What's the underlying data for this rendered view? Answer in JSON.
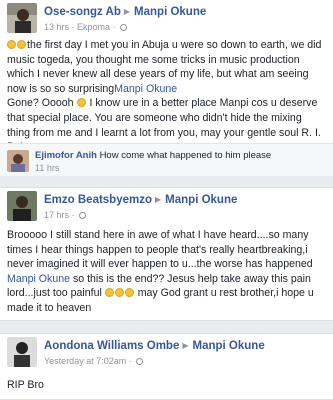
{
  "posts": [
    {
      "author": "Ose-songz Ab",
      "target": "Manpi Okune",
      "time": "13 hrs",
      "location": "Ekpoma",
      "text_a": "the first day I met you in Abuja u were so down to earth, we did music togeda, you thought me some tricks in music production which I never knew all dese years of my life, but what am seeing now is so so surprising",
      "mention": "Manpi Okune",
      "text_b": "Gone? Ooooh",
      "text_c": " I know ure in a better place Manpi cos u deserve that special place. You are someone who didn't hide the mixing thing from me and I learnt a lot from you, may your gentle soul R. I. P. Amen",
      "comment": {
        "author": "Ejimofor Anih",
        "text": "How come what happened to him please",
        "time": "11 hrs"
      }
    },
    {
      "author": "Emzo Beatsbyemzo",
      "target": "Manpi Okune",
      "time": "17 hrs",
      "text_a": "Brooooo I still stand here in awe of what I have heard....so many times I hear things happen to people that's really heartbreaking,i never imagined it will ever happen to u...the worse has happened",
      "mention": "Manpi Okune",
      "text_b": " so this is the end?? Jesus help take away this pain lord...just too painful ",
      "text_c": " may God grant u rest brother,i hope u made it to heaven"
    },
    {
      "author": "Aondona Williams Ombe",
      "target": "Manpi Okune",
      "time": "Yesterday at 7:02am",
      "text": "RIP Bro"
    }
  ],
  "colors": {
    "link": "#365899",
    "meta": "#90949c",
    "bg": "#e9ebee"
  }
}
